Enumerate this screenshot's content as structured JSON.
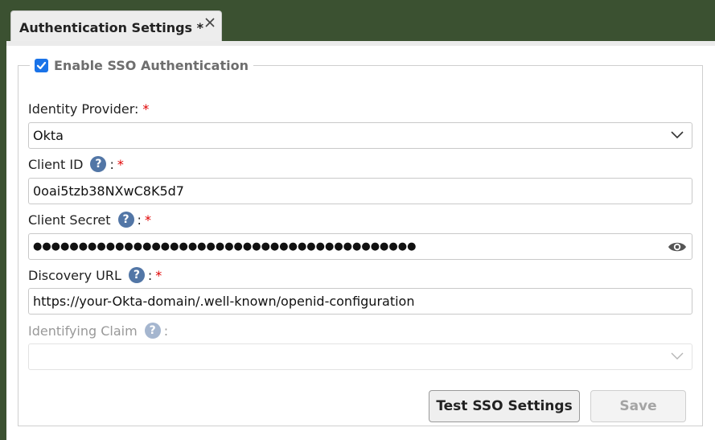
{
  "tab": {
    "title": "Authentication Settings *"
  },
  "sso": {
    "enable_label": "Enable SSO Authentication",
    "enabled": true
  },
  "fields": {
    "identity_provider": {
      "label": "Identity Provider:",
      "required": "*",
      "value": "Okta"
    },
    "client_id": {
      "label": "Client ID",
      "colon": ":",
      "required": "*",
      "value": "0oai5tzb38NXwC8K5d7"
    },
    "client_secret": {
      "label": "Client Secret",
      "colon": ":",
      "required": "*",
      "masked_value": "●●●●●●●●●●●●●●●●●●●●●●●●●●●●●●●●●●●●●●●●●●"
    },
    "discovery_url": {
      "label": "Discovery URL",
      "colon": ":",
      "required": "*",
      "value": "https://your-Okta-domain/.well-known/openid-configuration"
    },
    "identifying_claim": {
      "label": "Identifying Claim",
      "colon": ":",
      "value": ""
    }
  },
  "help_glyph": "?",
  "buttons": {
    "test": "Test SSO Settings",
    "save": "Save"
  },
  "colors": {
    "accent": "#1a73e8",
    "help": "#5276a6",
    "required": "#e00000",
    "background": "#3b5131"
  },
  "icons": [
    "close-icon",
    "checkbox-checked-icon",
    "help-icon",
    "chevron-down-icon",
    "eye-icon"
  ]
}
